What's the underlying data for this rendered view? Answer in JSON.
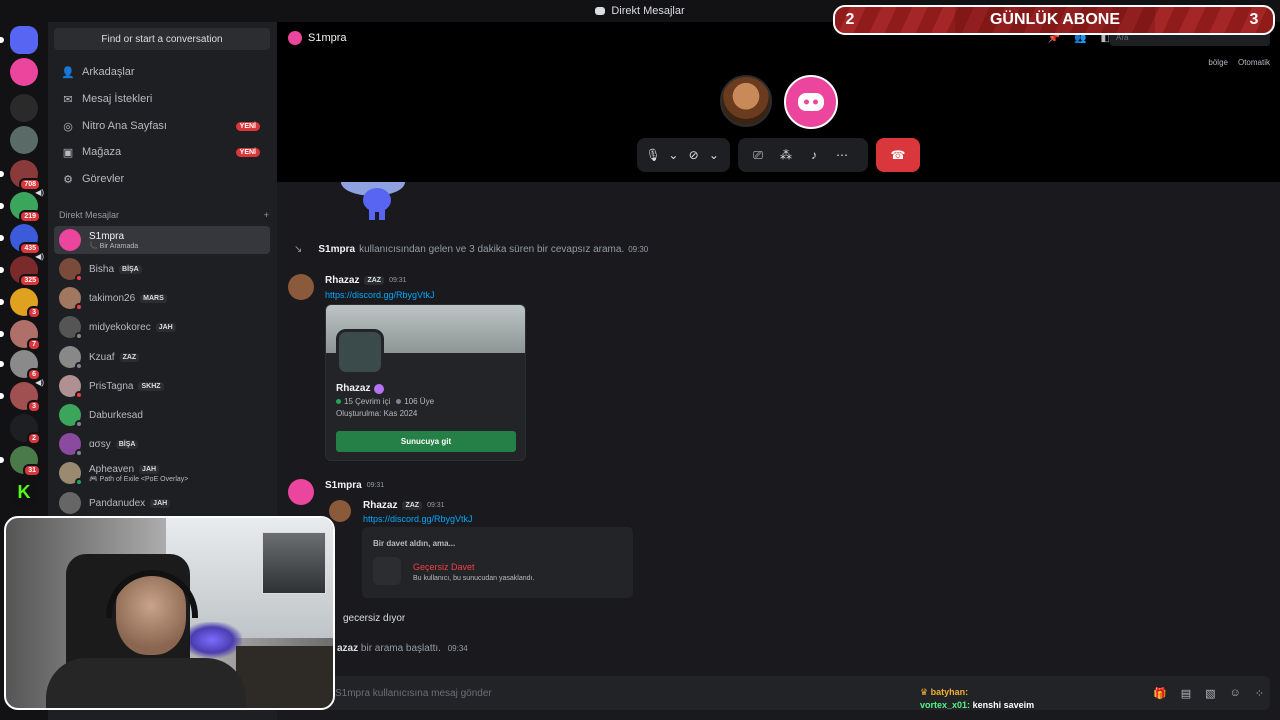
{
  "titlebar": {
    "title": "Direkt Mesajlar"
  },
  "overlay": {
    "left_num": "2",
    "title": "GÜNLÜK ABONE",
    "right_num": "3"
  },
  "server_badges": [
    "708",
    "219",
    "435",
    "325",
    "3",
    "7",
    "6",
    "3",
    "2",
    "31"
  ],
  "sidebar": {
    "search_label": "Find or start a conversation",
    "nav": [
      {
        "label": "Arkadaşlar",
        "icon": "friends-icon"
      },
      {
        "label": "Mesaj İstekleri",
        "icon": "mail-icon"
      },
      {
        "label": "Nitro Ana Sayfası",
        "icon": "nitro-icon",
        "badge": "YENİ"
      },
      {
        "label": "Mağaza",
        "icon": "shop-icon",
        "badge": "YENİ"
      },
      {
        "label": "Görevler",
        "icon": "quests-icon"
      }
    ],
    "dm_header": "Direkt Mesajlar",
    "dms": [
      {
        "name": "S1mpra",
        "sub": "Bir Aramada"
      },
      {
        "name": "Bisha",
        "tag": "BİŞA"
      },
      {
        "name": "takimon26",
        "tag": "MARS"
      },
      {
        "name": "midyekokorec",
        "tag": "JAH"
      },
      {
        "name": "Kzuaf",
        "tag": "ZAZ"
      },
      {
        "name": "PrisTagna",
        "tag": "SKHZ"
      },
      {
        "name": "Daburkesad"
      },
      {
        "name": "ɑσsy",
        "tag": "BİŞA"
      },
      {
        "name": "Apheaven",
        "tag": "JAH",
        "sub": "Path of Exile <PoE Overlay>"
      },
      {
        "name": "Pandanudex",
        "tag": "JAH"
      }
    ]
  },
  "header": {
    "name": "S1mpra",
    "search_placeholder": "Ara"
  },
  "call": {
    "region_label": "bölge",
    "region_value": "Otomatik"
  },
  "chat": {
    "system": {
      "user": "S1mpra",
      "text": "kullanıcısından gelen ve 3 dakika süren bir cevapsız arama.",
      "time": "09:30"
    },
    "msg1": {
      "user": "Rhazaz",
      "tag": "ZAZ",
      "time": "09:31",
      "link": "https://discord.gg/RbygVtkJ"
    },
    "invite": {
      "server": "Rhazaz",
      "online": "15 Çevrim içi",
      "members": "106 Üye",
      "created": "Oluşturulma: Kas 2024",
      "join": "Sunucuya git"
    },
    "msg2": {
      "user": "S1mpra",
      "time": "09:31"
    },
    "reply": {
      "user": "Rhazaz",
      "tag": "ZAZ",
      "time": "09:31",
      "link": "https://discord.gg/RbygVtkJ"
    },
    "invalid": {
      "title": "Bir davet aldın, ama...",
      "status": "Geçersiz Davet",
      "desc": "Bu kullanıcı, bu sunucudan yasaklandı."
    },
    "line1": "gecersiz dıyor",
    "line2": {
      "user": "azaz",
      "text": "bir arama başlattı.",
      "time": "09:34"
    }
  },
  "composer": {
    "placeholder": "S1mpra kullanıcısına mesaj gönder"
  },
  "twitch_chat": [
    {
      "user": "batyhan:",
      "msg": ""
    },
    {
      "user": "vortex_x01:",
      "msg": "kenshi saveim"
    }
  ]
}
